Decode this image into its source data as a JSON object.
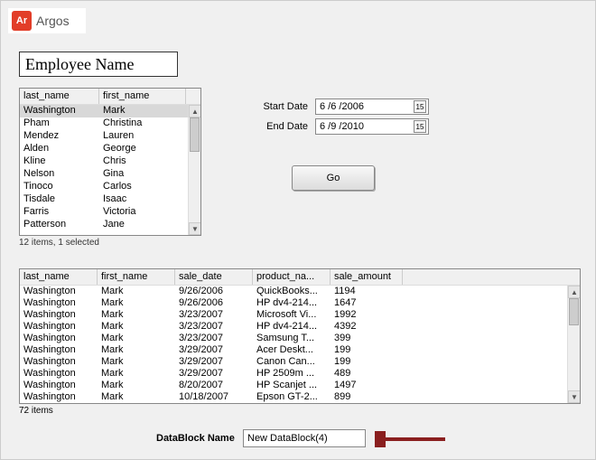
{
  "app": {
    "logo_text": "Ar",
    "name": "Argos"
  },
  "title": "Employee Name",
  "employee_list": {
    "columns": [
      "last_name",
      "first_name"
    ],
    "rows": [
      {
        "last": "Washington",
        "first": "Mark",
        "selected": true
      },
      {
        "last": "Pham",
        "first": "Christina"
      },
      {
        "last": "Mendez",
        "first": "Lauren"
      },
      {
        "last": "Alden",
        "first": "George"
      },
      {
        "last": "Kline",
        "first": "Chris"
      },
      {
        "last": "Nelson",
        "first": "Gina"
      },
      {
        "last": "Tinoco",
        "first": "Carlos"
      },
      {
        "last": "Tisdale",
        "first": "Isaac"
      },
      {
        "last": "Farris",
        "first": "Victoria"
      },
      {
        "last": "Patterson",
        "first": "Jane"
      }
    ],
    "status": "12 items, 1 selected"
  },
  "dates": {
    "start_label": "Start Date",
    "start_value": "6 /6 /2006",
    "end_label": "End Date",
    "end_value": "6 /9 /2010"
  },
  "go_label": "Go",
  "sales_list": {
    "columns": [
      "last_name",
      "first_name",
      "sale_date",
      "product_na...",
      "sale_amount"
    ],
    "rows": [
      {
        "last": "Washington",
        "first": "Mark",
        "date": "9/26/2006",
        "prod": "QuickBooks...",
        "amt": "1194"
      },
      {
        "last": "Washington",
        "first": "Mark",
        "date": "9/26/2006",
        "prod": "HP dv4-214...",
        "amt": "1647"
      },
      {
        "last": "Washington",
        "first": "Mark",
        "date": "3/23/2007",
        "prod": "Microsoft Vi...",
        "amt": "1992"
      },
      {
        "last": "Washington",
        "first": "Mark",
        "date": "3/23/2007",
        "prod": "HP dv4-214...",
        "amt": "4392"
      },
      {
        "last": "Washington",
        "first": "Mark",
        "date": "3/23/2007",
        "prod": "Samsung T...",
        "amt": "399"
      },
      {
        "last": "Washington",
        "first": "Mark",
        "date": "3/29/2007",
        "prod": "Acer Deskt...",
        "amt": "199"
      },
      {
        "last": "Washington",
        "first": "Mark",
        "date": "3/29/2007",
        "prod": "Canon Can...",
        "amt": "199"
      },
      {
        "last": "Washington",
        "first": "Mark",
        "date": "3/29/2007",
        "prod": "HP 2509m ...",
        "amt": "489"
      },
      {
        "last": "Washington",
        "first": "Mark",
        "date": "8/20/2007",
        "prod": "HP Scanjet ...",
        "amt": "1497"
      },
      {
        "last": "Washington",
        "first": "Mark",
        "date": "10/18/2007",
        "prod": "Epson GT-2...",
        "amt": "899"
      }
    ],
    "status": "72 items"
  },
  "datablock": {
    "label": "DataBlock Name",
    "value": "New DataBlock(4)"
  },
  "icons": {
    "calendar_glyph": "15"
  }
}
